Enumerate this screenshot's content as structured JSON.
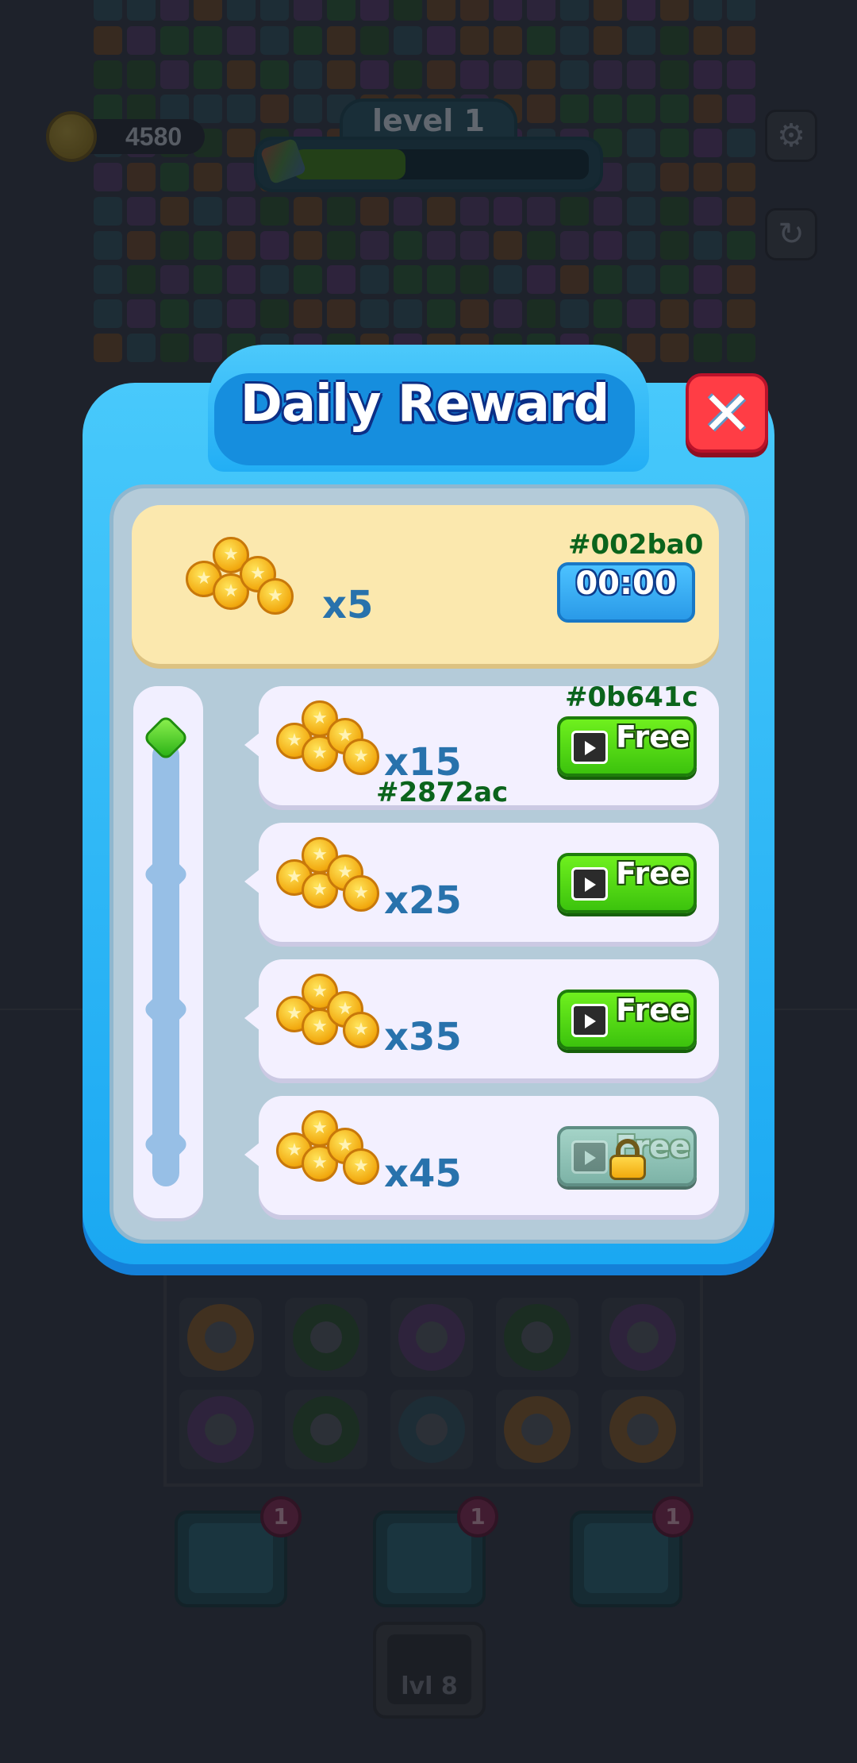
{
  "hud": {
    "coins": "4580",
    "level_label": "level 1",
    "level_progress": 0.38,
    "settings_icon": "gear-icon",
    "restart_icon": "restart-icon"
  },
  "dialog": {
    "title": "Daily Reward",
    "close_icon": "close-icon",
    "top_reward": {
      "multiplier": "x5",
      "color_tag": "#002ba0",
      "timer": "00:00"
    },
    "rewards": [
      {
        "multiplier": "x15",
        "button": "Free",
        "locked": false,
        "color_tag": "#0b641c",
        "sub_tag": "#2872ac"
      },
      {
        "multiplier": "x25",
        "button": "Free",
        "locked": false
      },
      {
        "multiplier": "x35",
        "button": "Free",
        "locked": false
      },
      {
        "multiplier": "x45",
        "button": "Free",
        "locked": true
      }
    ],
    "track_active_index": 0
  },
  "boosters": [
    {
      "name": "shuffle-booster",
      "count": "1"
    },
    {
      "name": "hammer-booster",
      "count": "1"
    },
    {
      "name": "glove-booster",
      "count": "1"
    }
  ],
  "locked_slot": {
    "label": "lvl 8"
  },
  "colors": {
    "accent_blue": "#1aa8f2",
    "free_green": "#3cc30d",
    "close_red": "#ff3d45",
    "coin_gold": "#f2a90f",
    "mult_blue": "#2872ac",
    "tag_navy": "#002ba0",
    "tag_green": "#0b641c"
  }
}
